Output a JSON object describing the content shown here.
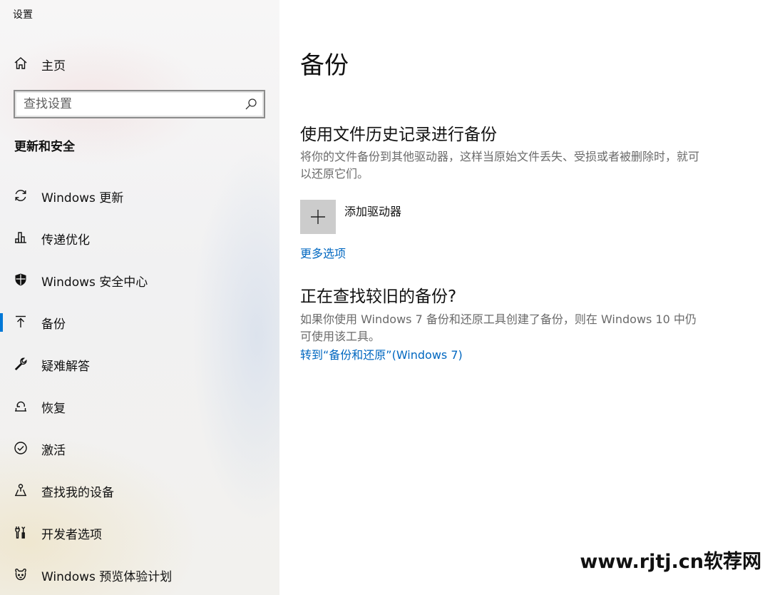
{
  "window": {
    "title": "设置"
  },
  "sidebar": {
    "home": {
      "label": "主页",
      "icon": "home-icon"
    },
    "search": {
      "placeholder": "查找设置",
      "value": ""
    },
    "section_title": "更新和安全",
    "items": [
      {
        "label": "Windows 更新",
        "icon": "sync-icon",
        "selected": false
      },
      {
        "label": "传递优化",
        "icon": "delivery-optimization-icon",
        "selected": false
      },
      {
        "label": "Windows 安全中心",
        "icon": "shield-icon",
        "selected": false
      },
      {
        "label": "备份",
        "icon": "backup-arrow-icon",
        "selected": true
      },
      {
        "label": "疑难解答",
        "icon": "wrench-icon",
        "selected": false
      },
      {
        "label": "恢复",
        "icon": "recovery-icon",
        "selected": false
      },
      {
        "label": "激活",
        "icon": "check-circle-icon",
        "selected": false
      },
      {
        "label": "查找我的设备",
        "icon": "find-device-icon",
        "selected": false
      },
      {
        "label": "开发者选项",
        "icon": "developer-tools-icon",
        "selected": false
      },
      {
        "label": "Windows 预览体验计划",
        "icon": "insider-icon",
        "selected": false
      }
    ]
  },
  "main": {
    "title": "备份",
    "file_history": {
      "heading": "使用文件历史记录进行备份",
      "description": "将你的文件备份到其他驱动器，这样当原始文件丢失、受损或者被删除时，就可以还原它们。",
      "add_drive_label": "添加驱动器",
      "more_options_link": "更多选项"
    },
    "older_backup": {
      "heading": "正在查找较旧的备份?",
      "description": "如果你使用 Windows 7 备份和还原工具创建了备份，则在 Windows 10 中仍可使用该工具。",
      "link": "转到“备份和还原”(Windows 7)"
    }
  },
  "watermark": "www.rjtj.cn软荐网",
  "colors": {
    "accent": "#0078d7",
    "link": "#0067c0",
    "tile": "#cccccc"
  }
}
